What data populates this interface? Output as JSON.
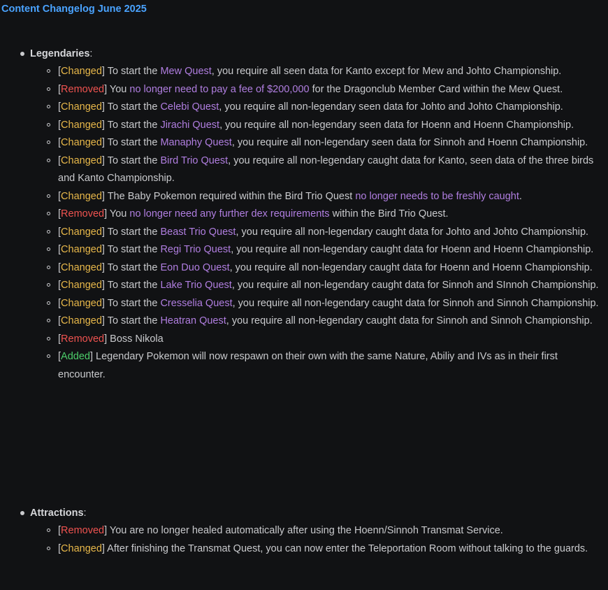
{
  "title": "Content Changelog June 2025",
  "colors": {
    "title": "#4aa3ff",
    "changed": "#e8b84a",
    "removed": "#ef5350",
    "added": "#4cce6a",
    "highlight": "#b07ee0",
    "text": "#c9cacd",
    "background": "#111214"
  },
  "sections": [
    {
      "name": "Legendaries",
      "items": [
        {
          "tag": "Changed",
          "a": " To start the ",
          "hl": "Mew Quest",
          "b": ", you require all seen data for Kanto except for Mew and Johto Championship."
        },
        {
          "tag": "Removed",
          "a": " You ",
          "hl": "no longer need to pay a fee of $200,000",
          "b": " for the Dragonclub Member Card within the Mew Quest."
        },
        {
          "tag": "Changed",
          "a": " To start the ",
          "hl": "Celebi Quest",
          "b": ", you require all non-legendary seen data for Johto and Johto Championship."
        },
        {
          "tag": "Changed",
          "a": " To start the ",
          "hl": "Jirachi Quest",
          "b": ", you require all non-legendary seen data for Hoenn and Hoenn Championship."
        },
        {
          "tag": "Changed",
          "a": " To start the ",
          "hl": "Manaphy Quest",
          "b": ", you require all non-legendary seen data for Sinnoh and Hoenn Championship."
        },
        {
          "tag": "Changed",
          "a": " To start the ",
          "hl": "Bird Trio Quest",
          "b": ", you require all non-legendary caught data for Kanto, seen data of the three birds and Kanto Championship."
        },
        {
          "tag": "Changed",
          "a": " The Baby Pokemon required within the Bird Trio Quest ",
          "hl": "no longer needs to be freshly caught",
          "b": "."
        },
        {
          "tag": "Removed",
          "a": " You ",
          "hl": "no longer need any further dex requirements",
          "b": " within the Bird Trio Quest."
        },
        {
          "tag": "Changed",
          "a": " To start the ",
          "hl": "Beast Trio Quest",
          "b": ", you require all non-legendary caught data for Johto and Johto Championship."
        },
        {
          "tag": "Changed",
          "a": " To start the ",
          "hl": "Regi Trio Quest",
          "b": ", you require all non-legendary caught data for Hoenn and Hoenn Championship."
        },
        {
          "tag": "Changed",
          "a": " To start the ",
          "hl": "Eon Duo Quest",
          "b": ", you require all non-legendary caught data for Hoenn and Hoenn Championship."
        },
        {
          "tag": "Changed",
          "a": " To start the ",
          "hl": "Lake Trio Quest",
          "b": ", you require all non-legendary caught data for Sinnoh and SInnoh Championship."
        },
        {
          "tag": "Changed",
          "a": " To start the ",
          "hl": "Cresselia Quest",
          "b": ", you require all non-legendary caught data for Sinnoh and Sinnoh Championship."
        },
        {
          "tag": "Changed",
          "a": " To start the ",
          "hl": "Heatran Quest",
          "b": ", you require all non-legendary caught data for Sinnoh and Sinnoh Championship."
        },
        {
          "tag": "Removed",
          "a": " Boss Nikola",
          "hl": "",
          "b": ""
        },
        {
          "tag": "Added",
          "a": " Legendary Pokemon will now respawn on their own with the same Nature, Abiliy and IVs as in their first encounter.",
          "hl": "",
          "b": ""
        }
      ]
    },
    {
      "name": "Attractions",
      "items": [
        {
          "tag": "Removed",
          "a": " You are no longer healed automatically after using the Hoenn/Sinnoh Transmat Service.",
          "hl": "",
          "b": ""
        },
        {
          "tag": "Changed",
          "a": " After finishing the Transmat Quest, you can now enter the Teleportation Room without talking to the guards.",
          "hl": "",
          "b": ""
        }
      ]
    }
  ]
}
